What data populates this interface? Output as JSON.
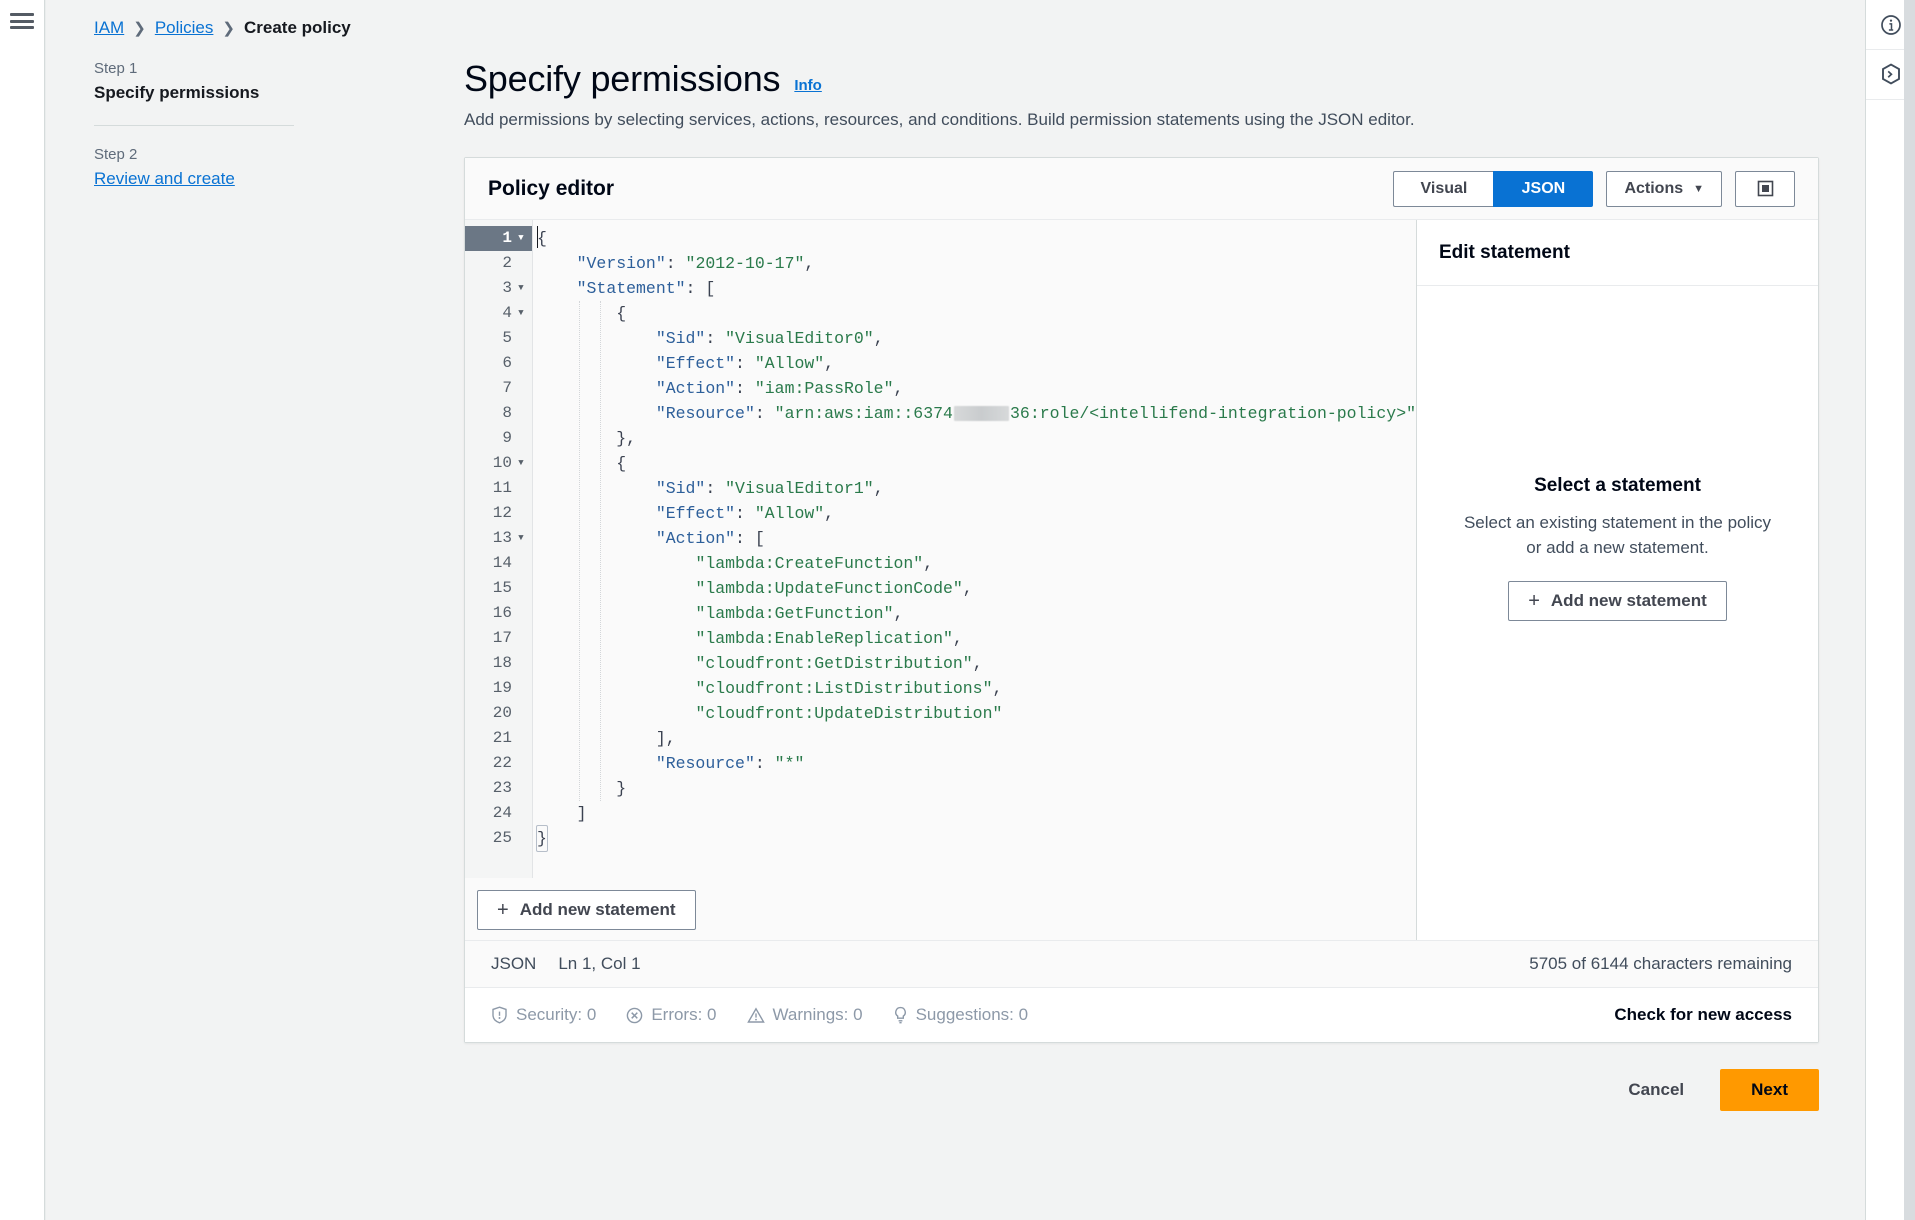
{
  "nav": {
    "menu_icon": "hamburger-icon"
  },
  "right_rail": {
    "items": [
      {
        "icon": "info-circle-icon"
      },
      {
        "icon": "cloudshell-hexagon-icon"
      }
    ]
  },
  "breadcrumb": {
    "items": [
      {
        "label": "IAM",
        "link": true
      },
      {
        "label": "Policies",
        "link": true
      },
      {
        "label": "Create policy",
        "link": false
      }
    ],
    "separator": "❯"
  },
  "steps": [
    {
      "step_label": "Step 1",
      "title": "Specify permissions",
      "active": true
    },
    {
      "step_label": "Step 2",
      "title": "Review and create",
      "active": false
    }
  ],
  "header": {
    "title": "Specify permissions",
    "info_label": "Info",
    "description": "Add permissions by selecting services, actions, resources, and conditions. Build permission statements using the JSON editor."
  },
  "card": {
    "title": "Policy editor",
    "editor_modes": [
      {
        "label": "Visual",
        "active": false
      },
      {
        "label": "JSON",
        "active": true
      }
    ],
    "actions_label": "Actions",
    "actions_caret": "▼",
    "fullscreen_icon": "fullscreen-icon"
  },
  "editor": {
    "language": "JSON",
    "cursor_position": "Ln 1, Col 1",
    "characters_remaining": "5705 of 6144 characters remaining",
    "add_statement_label": "Add new statement",
    "add_statement_icon": "plus-icon",
    "current_line": 1,
    "fold_lines": [
      1,
      3,
      4,
      10,
      13
    ],
    "lines": [
      {
        "n": 1,
        "tokens": [
          {
            "t": "punc",
            "v": "{"
          }
        ]
      },
      {
        "n": 2,
        "tokens": [
          {
            "t": "plain",
            "v": "    "
          },
          {
            "t": "key",
            "v": "\"Version\""
          },
          {
            "t": "punc",
            "v": ": "
          },
          {
            "t": "str",
            "v": "\"2012-10-17\""
          },
          {
            "t": "punc",
            "v": ","
          }
        ]
      },
      {
        "n": 3,
        "tokens": [
          {
            "t": "plain",
            "v": "    "
          },
          {
            "t": "key",
            "v": "\"Statement\""
          },
          {
            "t": "punc",
            "v": ": ["
          }
        ]
      },
      {
        "n": 4,
        "tokens": [
          {
            "t": "plain",
            "v": "        "
          },
          {
            "t": "punc",
            "v": "{"
          }
        ]
      },
      {
        "n": 5,
        "tokens": [
          {
            "t": "plain",
            "v": "            "
          },
          {
            "t": "key",
            "v": "\"Sid\""
          },
          {
            "t": "punc",
            "v": ": "
          },
          {
            "t": "str",
            "v": "\"VisualEditor0\""
          },
          {
            "t": "punc",
            "v": ","
          }
        ]
      },
      {
        "n": 6,
        "tokens": [
          {
            "t": "plain",
            "v": "            "
          },
          {
            "t": "key",
            "v": "\"Effect\""
          },
          {
            "t": "punc",
            "v": ": "
          },
          {
            "t": "str",
            "v": "\"Allow\""
          },
          {
            "t": "punc",
            "v": ","
          }
        ]
      },
      {
        "n": 7,
        "tokens": [
          {
            "t": "plain",
            "v": "            "
          },
          {
            "t": "key",
            "v": "\"Action\""
          },
          {
            "t": "punc",
            "v": ": "
          },
          {
            "t": "str",
            "v": "\"iam:PassRole\""
          },
          {
            "t": "punc",
            "v": ","
          }
        ]
      },
      {
        "n": 8,
        "tokens": [
          {
            "t": "plain",
            "v": "            "
          },
          {
            "t": "key",
            "v": "\"Resource\""
          },
          {
            "t": "punc",
            "v": ": "
          },
          {
            "t": "str",
            "v": "\"arn:aws:iam::6374"
          },
          {
            "t": "redact",
            "v": ""
          },
          {
            "t": "str",
            "v": "36:role/<intellifend-integration-policy>\""
          }
        ]
      },
      {
        "n": 9,
        "tokens": [
          {
            "t": "plain",
            "v": "        "
          },
          {
            "t": "punc",
            "v": "},"
          }
        ]
      },
      {
        "n": 10,
        "tokens": [
          {
            "t": "plain",
            "v": "        "
          },
          {
            "t": "punc",
            "v": "{"
          }
        ]
      },
      {
        "n": 11,
        "tokens": [
          {
            "t": "plain",
            "v": "            "
          },
          {
            "t": "key",
            "v": "\"Sid\""
          },
          {
            "t": "punc",
            "v": ": "
          },
          {
            "t": "str",
            "v": "\"VisualEditor1\""
          },
          {
            "t": "punc",
            "v": ","
          }
        ]
      },
      {
        "n": 12,
        "tokens": [
          {
            "t": "plain",
            "v": "            "
          },
          {
            "t": "key",
            "v": "\"Effect\""
          },
          {
            "t": "punc",
            "v": ": "
          },
          {
            "t": "str",
            "v": "\"Allow\""
          },
          {
            "t": "punc",
            "v": ","
          }
        ]
      },
      {
        "n": 13,
        "tokens": [
          {
            "t": "plain",
            "v": "            "
          },
          {
            "t": "key",
            "v": "\"Action\""
          },
          {
            "t": "punc",
            "v": ": ["
          }
        ]
      },
      {
        "n": 14,
        "tokens": [
          {
            "t": "plain",
            "v": "                "
          },
          {
            "t": "str",
            "v": "\"lambda:CreateFunction\""
          },
          {
            "t": "punc",
            "v": ","
          }
        ]
      },
      {
        "n": 15,
        "tokens": [
          {
            "t": "plain",
            "v": "                "
          },
          {
            "t": "str",
            "v": "\"lambda:UpdateFunctionCode\""
          },
          {
            "t": "punc",
            "v": ","
          }
        ]
      },
      {
        "n": 16,
        "tokens": [
          {
            "t": "plain",
            "v": "                "
          },
          {
            "t": "str",
            "v": "\"lambda:GetFunction\""
          },
          {
            "t": "punc",
            "v": ","
          }
        ]
      },
      {
        "n": 17,
        "tokens": [
          {
            "t": "plain",
            "v": "                "
          },
          {
            "t": "str",
            "v": "\"lambda:EnableReplication\""
          },
          {
            "t": "punc",
            "v": ","
          }
        ]
      },
      {
        "n": 18,
        "tokens": [
          {
            "t": "plain",
            "v": "                "
          },
          {
            "t": "str",
            "v": "\"cloudfront:GetDistribution\""
          },
          {
            "t": "punc",
            "v": ","
          }
        ]
      },
      {
        "n": 19,
        "tokens": [
          {
            "t": "plain",
            "v": "                "
          },
          {
            "t": "str",
            "v": "\"cloudfront:ListDistributions\""
          },
          {
            "t": "punc",
            "v": ","
          }
        ]
      },
      {
        "n": 20,
        "tokens": [
          {
            "t": "plain",
            "v": "                "
          },
          {
            "t": "str",
            "v": "\"cloudfront:UpdateDistribution\""
          }
        ]
      },
      {
        "n": 21,
        "tokens": [
          {
            "t": "plain",
            "v": "            "
          },
          {
            "t": "punc",
            "v": "],"
          }
        ]
      },
      {
        "n": 22,
        "tokens": [
          {
            "t": "plain",
            "v": "            "
          },
          {
            "t": "key",
            "v": "\"Resource\""
          },
          {
            "t": "punc",
            "v": ": "
          },
          {
            "t": "str",
            "v": "\"*\""
          }
        ]
      },
      {
        "n": 23,
        "tokens": [
          {
            "t": "plain",
            "v": "        "
          },
          {
            "t": "punc",
            "v": "}"
          }
        ]
      },
      {
        "n": 24,
        "tokens": [
          {
            "t": "plain",
            "v": "    "
          },
          {
            "t": "punc",
            "v": "]"
          }
        ]
      },
      {
        "n": 25,
        "tokens": [
          {
            "t": "bracket",
            "v": "}"
          }
        ]
      }
    ]
  },
  "side_panel": {
    "header_title": "Edit statement",
    "empty_title": "Select a statement",
    "empty_description": "Select an existing statement in the policy or add a new statement.",
    "add_statement_label": "Add new statement",
    "add_statement_icon": "plus-icon"
  },
  "validation": {
    "items": [
      {
        "icon": "shield-icon",
        "label": "Security: 0"
      },
      {
        "icon": "error-circle-icon",
        "label": "Errors: 0"
      },
      {
        "icon": "warning-triangle-icon",
        "label": "Warnings: 0"
      },
      {
        "icon": "lightbulb-icon",
        "label": "Suggestions: 0"
      }
    ],
    "check_access_label": "Check for new access"
  },
  "footer": {
    "cancel_label": "Cancel",
    "next_label": "Next"
  },
  "colors": {
    "accent_blue": "#0972d3",
    "next_orange": "#ff9900",
    "page_bg": "#f2f3f3",
    "json_key": "#2d5f9a",
    "json_string": "#2a7a4b"
  }
}
